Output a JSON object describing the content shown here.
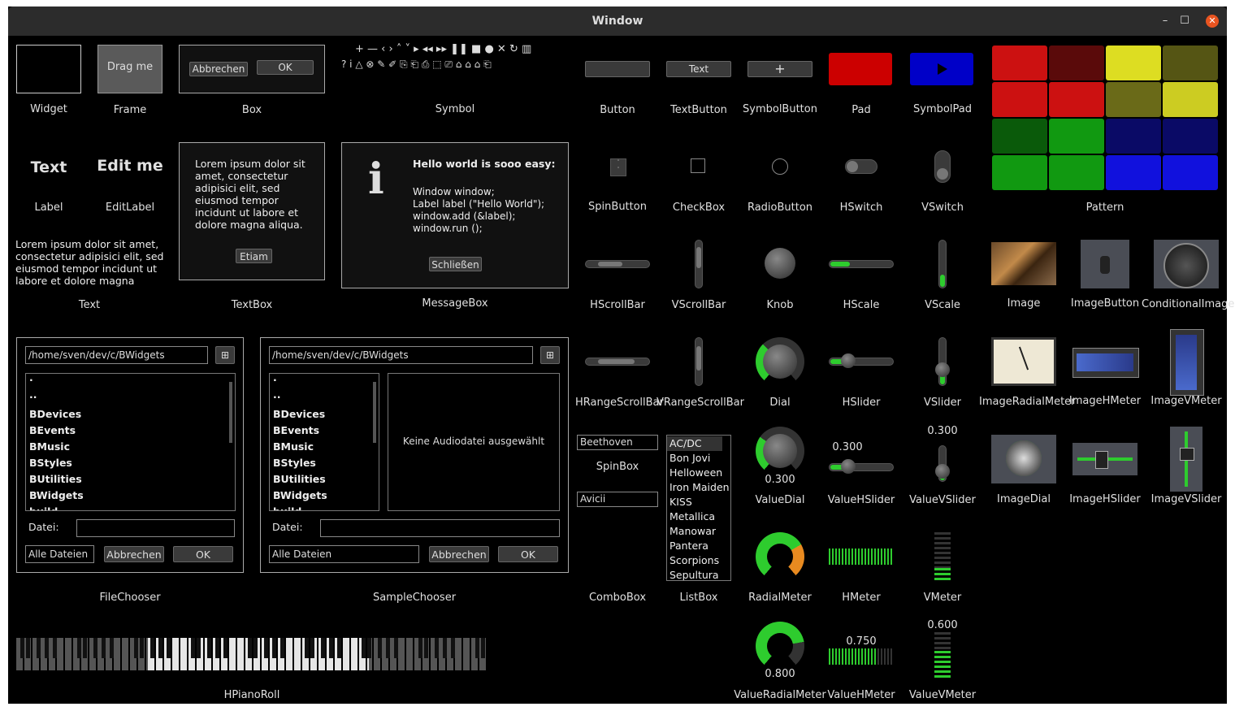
{
  "window": {
    "title": "Window",
    "minimize": "–",
    "maximize": "☐",
    "close": "✕"
  },
  "labels": {
    "widget": "Widget",
    "frame": "Frame",
    "box": "Box",
    "symbol": "Symbol",
    "button": "Button",
    "textbutton": "TextButton",
    "symbolbutton": "SymbolButton",
    "pad": "Pad",
    "symbolpad": "SymbolPad",
    "label": "Label",
    "editlabel": "EditLabel",
    "spinbutton": "SpinButton",
    "checkbox": "CheckBox",
    "radiobutton": "RadioButton",
    "hswitch": "HSwitch",
    "vswitch": "VSwitch",
    "pattern": "Pattern",
    "text": "Text",
    "textbox": "TextBox",
    "messagebox": "MessageBox",
    "hscrollbar": "HScrollBar",
    "vscrollbar": "VScrollBar",
    "knob": "Knob",
    "hscale": "HScale",
    "vscale": "VScale",
    "image": "Image",
    "imagebutton": "ImageButton",
    "conditionalimage": "ConditionalImage",
    "hrangescrollbar": "HRangeScrollBar",
    "vrangescrollbar": "VRangeScrollBar",
    "dial": "Dial",
    "hslider": "HSlider",
    "vslider": "VSlider",
    "imageradialmeter": "ImageRadialMeter",
    "imagehmeter": "ImageHMeter",
    "imagevmeter": "ImageVMeter",
    "spinbox": "SpinBox",
    "valuedial": "ValueDial",
    "valuehslider": "ValueHSlider",
    "valuevslider": "ValueVSlider",
    "imagedial": "ImageDial",
    "imagehslider": "ImageHSlider",
    "imagevslider": "ImageVSlider",
    "filechooser": "FileChooser",
    "samplechooser": "SampleChooser",
    "combobox": "ComboBox",
    "listbox": "ListBox",
    "radialmeter": "RadialMeter",
    "hmeter": "HMeter",
    "vmeter": "VMeter",
    "hpianoroll": "HPianoRoll",
    "valueradialmeter": "ValueRadialMeter",
    "valuehmeter": "ValueHMeter",
    "valuevmeter": "ValueVMeter"
  },
  "frame_text": "Drag me",
  "box": {
    "cancel": "Abbrechen",
    "ok": "OK"
  },
  "textbutton_text": "Text",
  "symbolbutton_text": "+",
  "label_text": "Text",
  "editlabel_text": "Edit me",
  "text_widget": "Lorem ipsum dolor sit amet, consectetur adipisici elit, sed eiusmod tempor incidunt ut labore et dolore magna",
  "textbox": {
    "text": "Lorem ipsum dolor sit amet, consectetur adipisici elit, sed eiusmod tempor incidunt ut labore et dolore magna aliqua.",
    "button": "Etiam"
  },
  "messagebox": {
    "icon": "i",
    "title": "Hello world is sooo easy:",
    "line1": "Window window;",
    "line2": "Label label (\"Hello World\");",
    "line3": "window.add (&label);",
    "line4": "window.run ();",
    "button": "Schließen"
  },
  "symbols_row1": "+ — ‹ › ˄ ˅ ▸ ◂◂ ▸▸ ❚❚ ■ ● ✕ ↻ ▥",
  "symbols_row2": "? i △ ⊗ ✎ ✐ ⎘ ⎗ ⎙ ⬚ ⎚ ⌂ ⌂ ⌂ ⎗",
  "values": {
    "valuedial": "0.300",
    "valuehslider": "0.300",
    "valuevslider": "0.300",
    "valueradialmeter": "0.800",
    "valuehmeter": "0.750",
    "valuevmeter": "0.600"
  },
  "filechooser": {
    "path": "/home/sven/dev/c/BWidgets",
    "items": [
      ".",
      "..",
      "BDevices",
      "BEvents",
      "BMusic",
      "BStyles",
      "BUtilities",
      "BWidgets",
      "build"
    ],
    "file_label": "Datei:",
    "filter": "Alle Dateien",
    "cancel": "Abbrechen",
    "ok": "OK"
  },
  "samplechooser": {
    "path": "/home/sven/dev/c/BWidgets",
    "items": [
      ".",
      "..",
      "BDevices",
      "BEvents",
      "BMusic",
      "BStyles",
      "BUtilities",
      "BWidgets",
      "build"
    ],
    "preview": "Keine Audiodatei ausgewählt",
    "file_label": "Datei:",
    "filter": "Alle Dateien",
    "cancel": "Abbrechen",
    "ok": "OK"
  },
  "spinbox_value": "Beethoven",
  "combobox_value": "Avicii",
  "listbox_items": [
    "AC/DC",
    "Bon Jovi",
    "Helloween",
    "Iron Maiden",
    "KISS",
    "Metallica",
    "Manowar",
    "Pantera",
    "Scorpions",
    "Sepultura"
  ],
  "colors": {
    "pad_red": "#cc0000",
    "symbolpad_blue": "#0000c8",
    "green": "#2ecc2e"
  }
}
